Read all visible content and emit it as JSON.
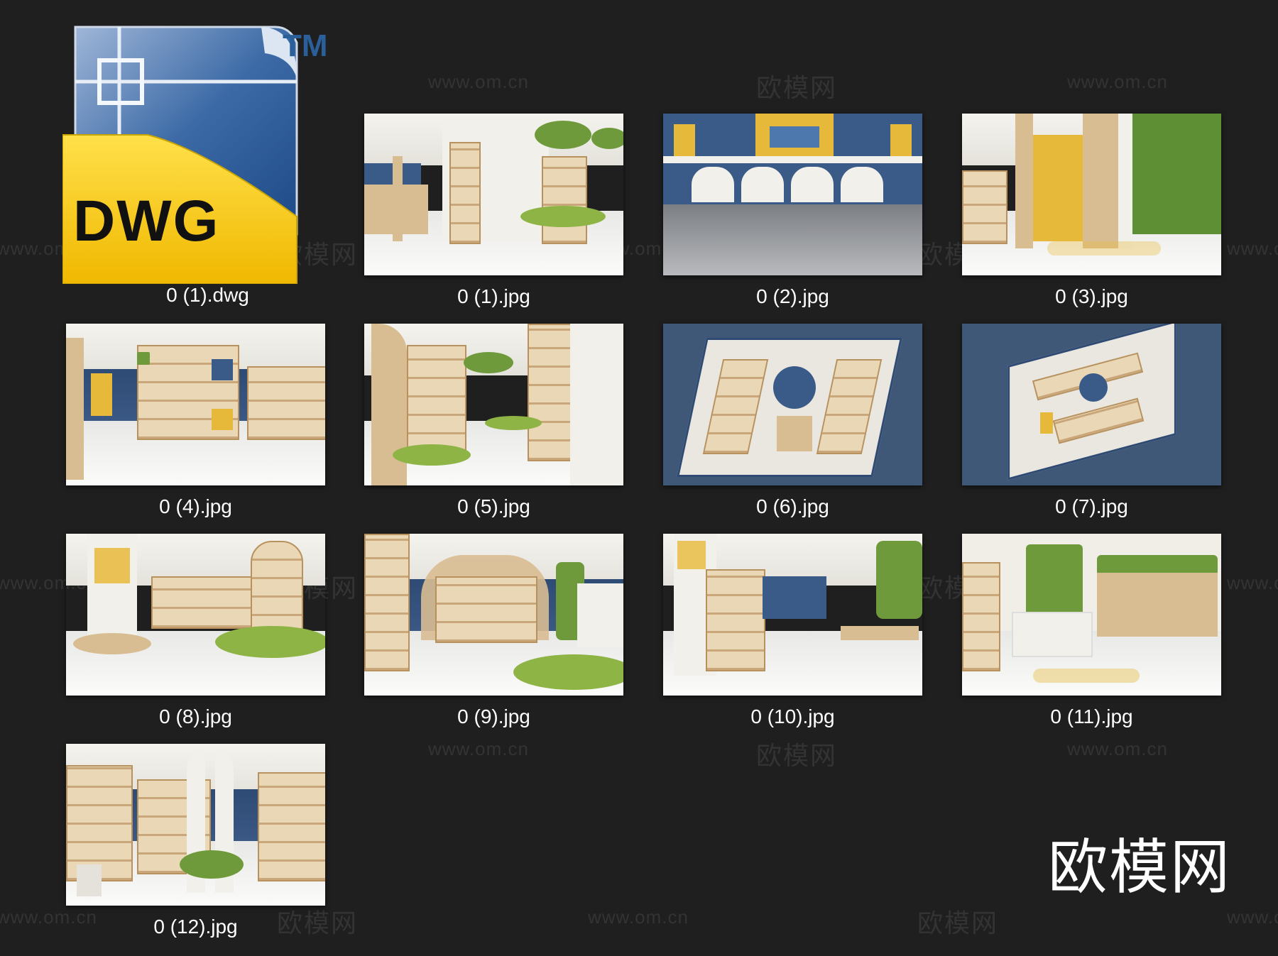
{
  "watermarks": {
    "url": "www.om.cn",
    "cn": "欧模网"
  },
  "brand_text": "欧模网",
  "dwg_icon": {
    "label": "DWG",
    "tm": "TM",
    "colors": {
      "blue": "#2b5f9a",
      "yellow": "#f3c418"
    }
  },
  "files": [
    {
      "name": "0 (1).dwg"
    },
    {
      "name": "0 (1).jpg"
    },
    {
      "name": "0 (2).jpg"
    },
    {
      "name": "0 (3).jpg"
    },
    {
      "name": "0 (4).jpg"
    },
    {
      "name": "0 (5).jpg"
    },
    {
      "name": "0 (6).jpg"
    },
    {
      "name": "0 (7).jpg"
    },
    {
      "name": "0 (8).jpg"
    },
    {
      "name": "0 (9).jpg"
    },
    {
      "name": "0 (10).jpg"
    },
    {
      "name": "0 (11).jpg"
    },
    {
      "name": "0 (12).jpg"
    }
  ]
}
